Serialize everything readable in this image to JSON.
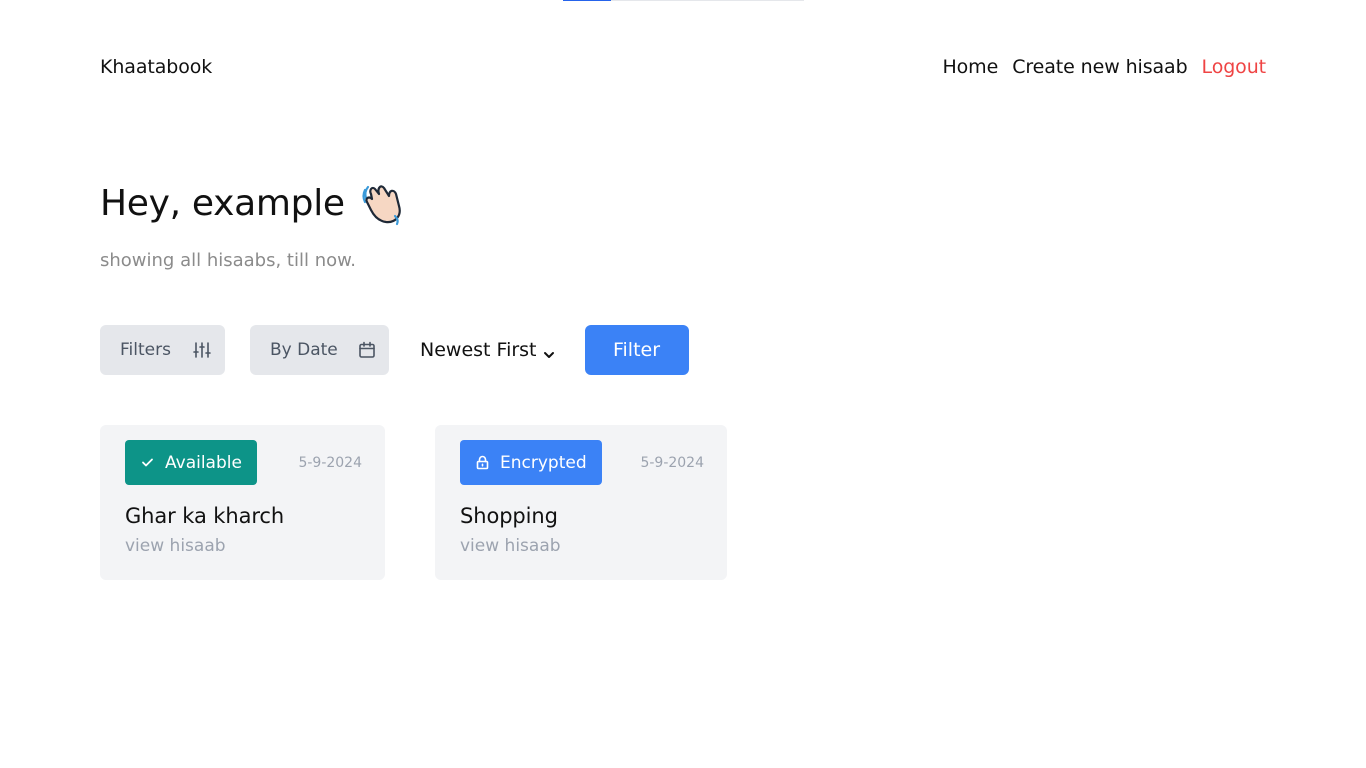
{
  "loading": {
    "progress": 0.2
  },
  "navbar": {
    "brand": "Khaatabook",
    "links": [
      {
        "label": "Home"
      },
      {
        "label": "Create new hisaab"
      },
      {
        "label": "Logout",
        "color": "#ef4444"
      }
    ]
  },
  "greeting": {
    "title": "Hey, example",
    "icon": "waving-hand-icon",
    "subtitle": "showing all hisaabs, till now."
  },
  "toolbar": {
    "filters_label": "Filters",
    "filters_icon": "sliders-icon",
    "by_date_label": "By Date",
    "by_date_icon": "calendar-icon",
    "sort_selected": "Newest First",
    "filter_button_label": "Filter",
    "accent_color": "#3b82f6"
  },
  "cards": [
    {
      "badge": {
        "label": "Available",
        "icon": "check-icon",
        "color": "#0d9488"
      },
      "date": "5-9-2024",
      "title": "Ghar ka kharch",
      "link": "view hisaab"
    },
    {
      "badge": {
        "label": "Encrypted",
        "icon": "lock-icon",
        "color": "#3b82f6"
      },
      "date": "5-9-2024",
      "title": "Shopping",
      "link": "view hisaab"
    }
  ]
}
